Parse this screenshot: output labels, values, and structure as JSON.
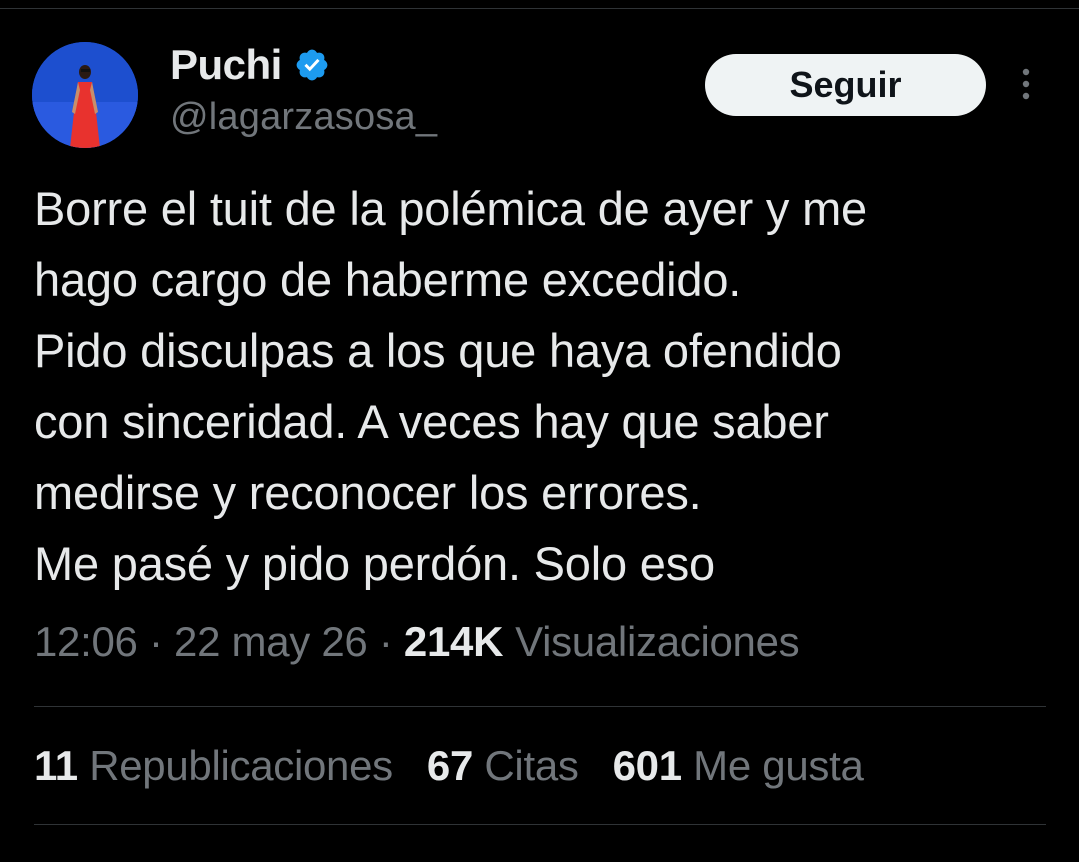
{
  "user": {
    "display_name": "Puchi",
    "handle": "@lagarzasosa_",
    "verified": true,
    "avatar_icon": "profile-photo-woman-red-dress-blue-background"
  },
  "actions": {
    "follow_label": "Seguir",
    "more_icon": "vertical-ellipsis-icon"
  },
  "tweet": {
    "lines": [
      "Borre el tuit de la polémica de ayer y me",
      "hago cargo de haberme excedido.",
      "Pido disculpas a los que haya ofendido",
      "con sinceridad. A veces hay que saber",
      "medirse y reconocer los errores.",
      "Me pasé y pido perdón. Solo eso"
    ]
  },
  "meta": {
    "time": "12:06",
    "separator": "·",
    "date": "22 may 26",
    "views_count": "214K",
    "views_label": "Visualizaciones"
  },
  "stats": [
    {
      "count": "11",
      "label": "Republicaciones"
    },
    {
      "count": "67",
      "label": "Citas"
    },
    {
      "count": "601",
      "label": "Me gusta"
    }
  ],
  "colors": {
    "background": "#000000",
    "text_primary": "#e7e9ea",
    "text_secondary": "#71767b",
    "verified_badge": "#1d9bf0",
    "divider": "#2f3336",
    "button_bg": "#eff3f4"
  }
}
